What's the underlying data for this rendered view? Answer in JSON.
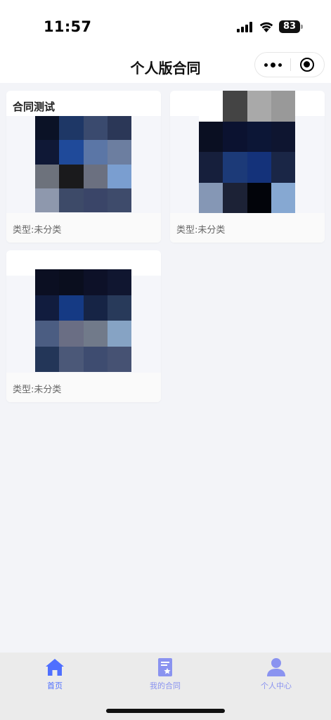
{
  "status_bar": {
    "time": "11:57",
    "battery_level": "83",
    "icons": [
      "signal-icon",
      "wifi-icon",
      "battery-icon"
    ]
  },
  "nav": {
    "title": "个人版合同",
    "capsule_icons": [
      "more-icon",
      "close-target-icon"
    ]
  },
  "cards": [
    {
      "title": "合同测试",
      "type_label": "类型:未分类",
      "thumb_colors": [
        "#0b1226",
        "#1e3766",
        "#3a4a6e",
        "#2b3757",
        "#0f1836",
        "#1f4a9a",
        "#5b76a6",
        "#6c7ea0",
        "#6d727c",
        "#1a1a1c",
        "#6b7080",
        "#7a9ed0",
        "#8e98ad",
        "#3d4a68",
        "#3a4568",
        "#3e4b6b"
      ]
    },
    {
      "title": "",
      "type_label": "类型:未分类",
      "thumb_colors": [
        "#ffffff",
        "#444444",
        "#a9a9a9",
        "#999999",
        "#0a0f22",
        "#0b1230",
        "#0c1636",
        "#0e1530",
        "#161f3c",
        "#1c3a78",
        "#14327a",
        "#1a2646",
        "#8597b5",
        "#1c2236",
        "#02040a",
        "#86a8d2"
      ]
    },
    {
      "title": "",
      "type_label": "类型:未分类",
      "thumb_colors": [
        "#0b0f22",
        "#0a0e1e",
        "#0d1128",
        "#101630",
        "#111c3e",
        "#153a84",
        "#162445",
        "#283a5a",
        "#4b5d82",
        "#6a6e84",
        "#717a8a",
        "#86a3c4",
        "#233658",
        "#4b5878",
        "#3e4c70",
        "#465273"
      ]
    }
  ],
  "tabbar": {
    "items": [
      {
        "label": "首页",
        "icon": "home-icon",
        "active": true
      },
      {
        "label": "我的合同",
        "icon": "contract-document-icon",
        "active": false
      },
      {
        "label": "个人中心",
        "icon": "user-icon",
        "active": false
      }
    ],
    "active_color": "#4f6fff",
    "inactive_color": "#8a93f0"
  }
}
